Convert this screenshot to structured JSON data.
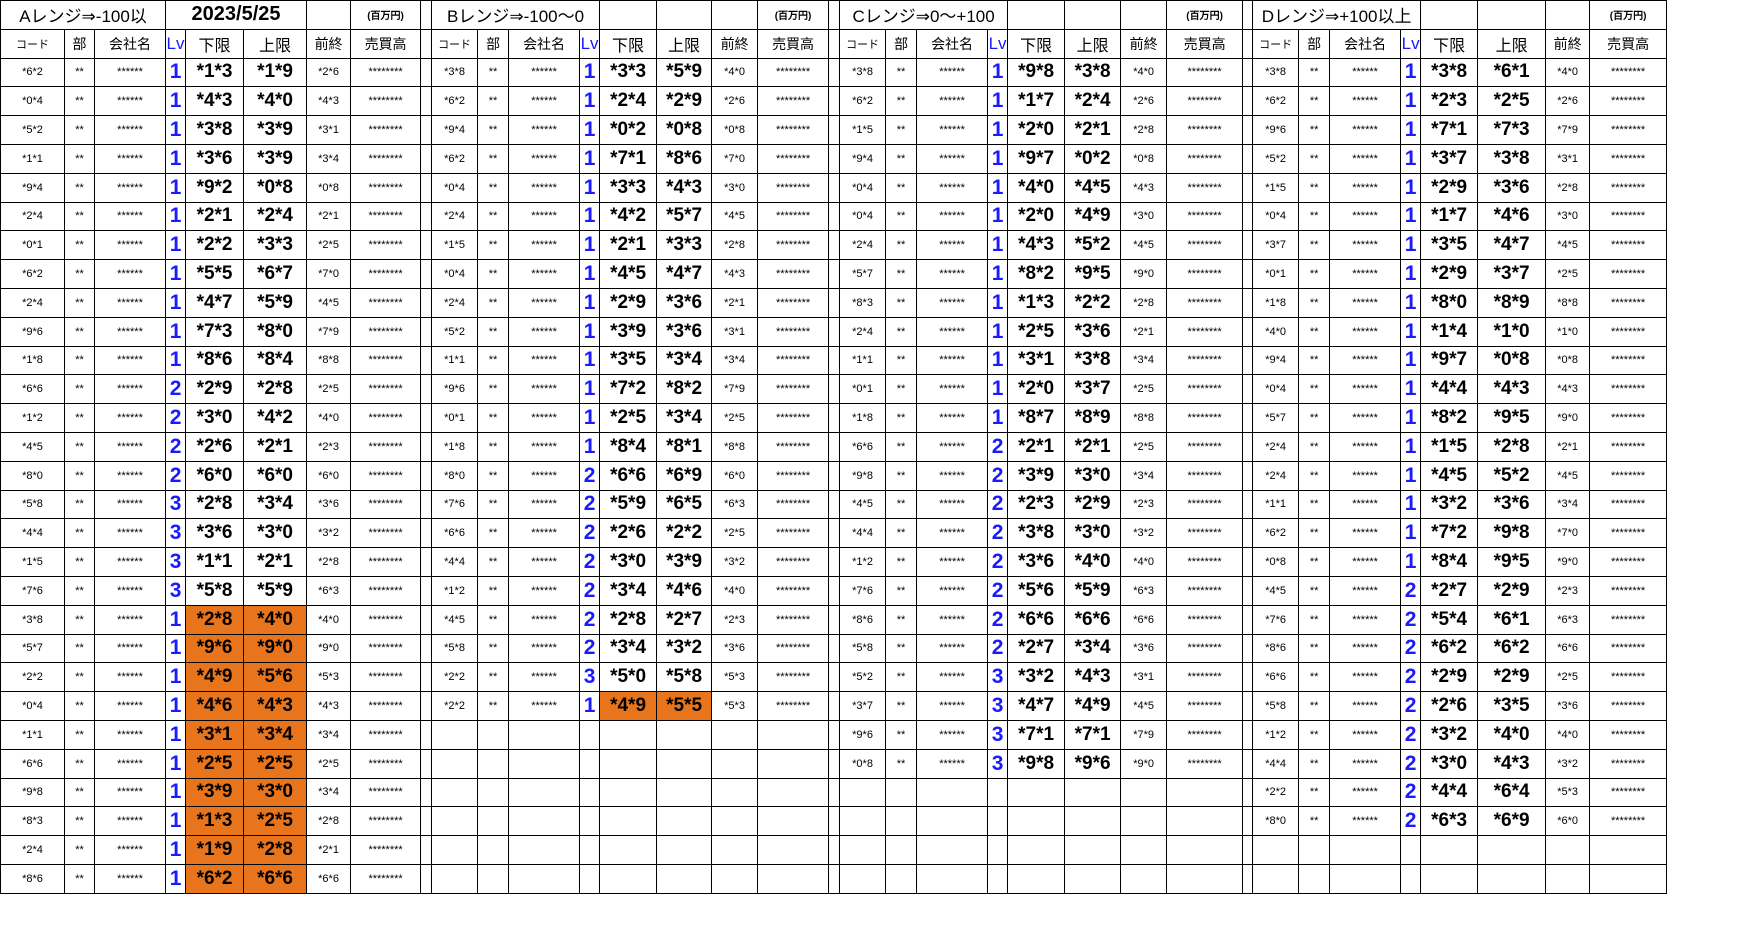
{
  "date": "2023/5/25",
  "unit": "(百万円)",
  "headers": [
    "コード",
    "部",
    "会社名",
    "Lv",
    "下限",
    "上限",
    "前終",
    "売買高"
  ],
  "panels": [
    {
      "title": "Aレンジ⇒-100以",
      "rows": [
        [
          "*6*2",
          "**",
          "******",
          "1",
          "*1*3",
          "*1*9",
          "*2*6",
          "********",
          false
        ],
        [
          "*0*4",
          "**",
          "******",
          "1",
          "*4*3",
          "*4*0",
          "*4*3",
          "********",
          false
        ],
        [
          "*5*2",
          "**",
          "******",
          "1",
          "*3*8",
          "*3*9",
          "*3*1",
          "********",
          false
        ],
        [
          "*1*1",
          "**",
          "******",
          "1",
          "*3*6",
          "*3*9",
          "*3*4",
          "********",
          false
        ],
        [
          "*9*4",
          "**",
          "******",
          "1",
          "*9*2",
          "*0*8",
          "*0*8",
          "********",
          false
        ],
        [
          "*2*4",
          "**",
          "******",
          "1",
          "*2*1",
          "*2*4",
          "*2*1",
          "********",
          false
        ],
        [
          "*0*1",
          "**",
          "******",
          "1",
          "*2*2",
          "*3*3",
          "*2*5",
          "********",
          false
        ],
        [
          "*6*2",
          "**",
          "******",
          "1",
          "*5*5",
          "*6*7",
          "*7*0",
          "********",
          false
        ],
        [
          "*2*4",
          "**",
          "******",
          "1",
          "*4*7",
          "*5*9",
          "*4*5",
          "********",
          false
        ],
        [
          "*9*6",
          "**",
          "******",
          "1",
          "*7*3",
          "*8*0",
          "*7*9",
          "********",
          false
        ],
        [
          "*1*8",
          "**",
          "******",
          "1",
          "*8*6",
          "*8*4",
          "*8*8",
          "********",
          false
        ],
        [
          "*6*6",
          "**",
          "******",
          "2",
          "*2*9",
          "*2*8",
          "*2*5",
          "********",
          false
        ],
        [
          "*1*2",
          "**",
          "******",
          "2",
          "*3*0",
          "*4*2",
          "*4*0",
          "********",
          false
        ],
        [
          "*4*5",
          "**",
          "******",
          "2",
          "*2*6",
          "*2*1",
          "*2*3",
          "********",
          false
        ],
        [
          "*8*0",
          "**",
          "******",
          "2",
          "*6*0",
          "*6*0",
          "*6*0",
          "********",
          false
        ],
        [
          "*5*8",
          "**",
          "******",
          "3",
          "*2*8",
          "*3*4",
          "*3*6",
          "********",
          false
        ],
        [
          "*4*4",
          "**",
          "******",
          "3",
          "*3*6",
          "*3*0",
          "*3*2",
          "********",
          false
        ],
        [
          "*1*5",
          "**",
          "******",
          "3",
          "*1*1",
          "*2*1",
          "*2*8",
          "********",
          false
        ],
        [
          "*7*6",
          "**",
          "******",
          "3",
          "*5*8",
          "*5*9",
          "*6*3",
          "********",
          false
        ],
        [
          "*3*8",
          "**",
          "******",
          "1",
          "*2*8",
          "*4*0",
          "*4*0",
          "********",
          true
        ],
        [
          "*5*7",
          "**",
          "******",
          "1",
          "*9*6",
          "*9*0",
          "*9*0",
          "********",
          true
        ],
        [
          "*2*2",
          "**",
          "******",
          "1",
          "*4*9",
          "*5*6",
          "*5*3",
          "********",
          true
        ],
        [
          "*0*4",
          "**",
          "******",
          "1",
          "*4*6",
          "*4*3",
          "*4*3",
          "********",
          true
        ],
        [
          "*1*1",
          "**",
          "******",
          "1",
          "*3*1",
          "*3*4",
          "*3*4",
          "********",
          true
        ],
        [
          "*6*6",
          "**",
          "******",
          "1",
          "*2*5",
          "*2*5",
          "*2*5",
          "********",
          true
        ],
        [
          "*9*8",
          "**",
          "******",
          "1",
          "*3*9",
          "*3*0",
          "*3*4",
          "********",
          true
        ],
        [
          "*8*3",
          "**",
          "******",
          "1",
          "*1*3",
          "*2*5",
          "*2*8",
          "********",
          true
        ],
        [
          "*2*4",
          "**",
          "******",
          "1",
          "*1*9",
          "*2*8",
          "*2*1",
          "********",
          true
        ],
        [
          "*8*6",
          "**",
          "******",
          "1",
          "*6*2",
          "*6*6",
          "*6*6",
          "********",
          true
        ]
      ]
    },
    {
      "title": "Bレンジ⇒-100～0",
      "rows": [
        [
          "*3*8",
          "**",
          "******",
          "1",
          "*3*3",
          "*5*9",
          "*4*0",
          "********",
          false
        ],
        [
          "*6*2",
          "**",
          "******",
          "1",
          "*2*4",
          "*2*9",
          "*2*6",
          "********",
          false
        ],
        [
          "*9*4",
          "**",
          "******",
          "1",
          "*0*2",
          "*0*8",
          "*0*8",
          "********",
          false
        ],
        [
          "*6*2",
          "**",
          "******",
          "1",
          "*7*1",
          "*8*6",
          "*7*0",
          "********",
          false
        ],
        [
          "*0*4",
          "**",
          "******",
          "1",
          "*3*3",
          "*4*3",
          "*3*0",
          "********",
          false
        ],
        [
          "*2*4",
          "**",
          "******",
          "1",
          "*4*2",
          "*5*7",
          "*4*5",
          "********",
          false
        ],
        [
          "*1*5",
          "**",
          "******",
          "1",
          "*2*1",
          "*3*3",
          "*2*8",
          "********",
          false
        ],
        [
          "*0*4",
          "**",
          "******",
          "1",
          "*4*5",
          "*4*7",
          "*4*3",
          "********",
          false
        ],
        [
          "*2*4",
          "**",
          "******",
          "1",
          "*2*9",
          "*3*6",
          "*2*1",
          "********",
          false
        ],
        [
          "*5*2",
          "**",
          "******",
          "1",
          "*3*9",
          "*3*6",
          "*3*1",
          "********",
          false
        ],
        [
          "*1*1",
          "**",
          "******",
          "1",
          "*3*5",
          "*3*4",
          "*3*4",
          "********",
          false
        ],
        [
          "*9*6",
          "**",
          "******",
          "1",
          "*7*2",
          "*8*2",
          "*7*9",
          "********",
          false
        ],
        [
          "*0*1",
          "**",
          "******",
          "1",
          "*2*5",
          "*3*4",
          "*2*5",
          "********",
          false
        ],
        [
          "*1*8",
          "**",
          "******",
          "1",
          "*8*4",
          "*8*1",
          "*8*8",
          "********",
          false
        ],
        [
          "*8*0",
          "**",
          "******",
          "2",
          "*6*6",
          "*6*9",
          "*6*0",
          "********",
          false
        ],
        [
          "*7*6",
          "**",
          "******",
          "2",
          "*5*9",
          "*6*5",
          "*6*3",
          "********",
          false
        ],
        [
          "*6*6",
          "**",
          "******",
          "2",
          "*2*6",
          "*2*2",
          "*2*5",
          "********",
          false
        ],
        [
          "*4*4",
          "**",
          "******",
          "2",
          "*3*0",
          "*3*9",
          "*3*2",
          "********",
          false
        ],
        [
          "*1*2",
          "**",
          "******",
          "2",
          "*3*4",
          "*4*6",
          "*4*0",
          "********",
          false
        ],
        [
          "*4*5",
          "**",
          "******",
          "2",
          "*2*8",
          "*2*7",
          "*2*3",
          "********",
          false
        ],
        [
          "*5*8",
          "**",
          "******",
          "2",
          "*3*4",
          "*3*2",
          "*3*6",
          "********",
          false
        ],
        [
          "*2*2",
          "**",
          "******",
          "3",
          "*5*0",
          "*5*8",
          "*5*3",
          "********",
          false
        ],
        [
          "*2*2",
          "**",
          "******",
          "1",
          "*4*9",
          "*5*5",
          "*5*3",
          "********",
          true
        ]
      ]
    },
    {
      "title": "Cレンジ⇒0～+100",
      "rows": [
        [
          "*3*8",
          "**",
          "******",
          "1",
          "*9*8",
          "*3*8",
          "*4*0",
          "********",
          false
        ],
        [
          "*6*2",
          "**",
          "******",
          "1",
          "*1*7",
          "*2*4",
          "*2*6",
          "********",
          false
        ],
        [
          "*1*5",
          "**",
          "******",
          "1",
          "*2*0",
          "*2*1",
          "*2*8",
          "********",
          false
        ],
        [
          "*9*4",
          "**",
          "******",
          "1",
          "*9*7",
          "*0*2",
          "*0*8",
          "********",
          false
        ],
        [
          "*0*4",
          "**",
          "******",
          "1",
          "*4*0",
          "*4*5",
          "*4*3",
          "********",
          false
        ],
        [
          "*0*4",
          "**",
          "******",
          "1",
          "*2*0",
          "*4*9",
          "*3*0",
          "********",
          false
        ],
        [
          "*2*4",
          "**",
          "******",
          "1",
          "*4*3",
          "*5*2",
          "*4*5",
          "********",
          false
        ],
        [
          "*5*7",
          "**",
          "******",
          "1",
          "*8*2",
          "*9*5",
          "*9*0",
          "********",
          false
        ],
        [
          "*8*3",
          "**",
          "******",
          "1",
          "*1*3",
          "*2*2",
          "*2*8",
          "********",
          false
        ],
        [
          "*2*4",
          "**",
          "******",
          "1",
          "*2*5",
          "*3*6",
          "*2*1",
          "********",
          false
        ],
        [
          "*1*1",
          "**",
          "******",
          "1",
          "*3*1",
          "*3*8",
          "*3*4",
          "********",
          false
        ],
        [
          "*0*1",
          "**",
          "******",
          "1",
          "*2*0",
          "*3*7",
          "*2*5",
          "********",
          false
        ],
        [
          "*1*8",
          "**",
          "******",
          "1",
          "*8*7",
          "*8*9",
          "*8*8",
          "********",
          false
        ],
        [
          "*6*6",
          "**",
          "******",
          "2",
          "*2*1",
          "*2*1",
          "*2*5",
          "********",
          false
        ],
        [
          "*9*8",
          "**",
          "******",
          "2",
          "*3*9",
          "*3*0",
          "*3*4",
          "********",
          false
        ],
        [
          "*4*5",
          "**",
          "******",
          "2",
          "*2*3",
          "*2*9",
          "*2*3",
          "********",
          false
        ],
        [
          "*4*4",
          "**",
          "******",
          "2",
          "*3*8",
          "*3*0",
          "*3*2",
          "********",
          false
        ],
        [
          "*1*2",
          "**",
          "******",
          "2",
          "*3*6",
          "*4*0",
          "*4*0",
          "********",
          false
        ],
        [
          "*7*6",
          "**",
          "******",
          "2",
          "*5*6",
          "*5*9",
          "*6*3",
          "********",
          false
        ],
        [
          "*8*6",
          "**",
          "******",
          "2",
          "*6*6",
          "*6*6",
          "*6*6",
          "********",
          false
        ],
        [
          "*5*8",
          "**",
          "******",
          "2",
          "*2*7",
          "*3*4",
          "*3*6",
          "********",
          false
        ],
        [
          "*5*2",
          "**",
          "******",
          "3",
          "*3*2",
          "*4*3",
          "*3*1",
          "********",
          false
        ],
        [
          "*3*7",
          "**",
          "******",
          "3",
          "*4*7",
          "*4*9",
          "*4*5",
          "********",
          false
        ],
        [
          "*9*6",
          "**",
          "******",
          "3",
          "*7*1",
          "*7*1",
          "*7*9",
          "********",
          false
        ],
        [
          "*0*8",
          "**",
          "******",
          "3",
          "*9*8",
          "*9*6",
          "*9*0",
          "********",
          false
        ]
      ]
    },
    {
      "title": "Dレンジ⇒+100以上",
      "rows": [
        [
          "*3*8",
          "**",
          "******",
          "1",
          "*3*8",
          "*6*1",
          "*4*0",
          "********",
          false
        ],
        [
          "*6*2",
          "**",
          "******",
          "1",
          "*2*3",
          "*2*5",
          "*2*6",
          "********",
          false
        ],
        [
          "*9*6",
          "**",
          "******",
          "1",
          "*7*1",
          "*7*3",
          "*7*9",
          "********",
          false
        ],
        [
          "*5*2",
          "**",
          "******",
          "1",
          "*3*7",
          "*3*8",
          "*3*1",
          "********",
          false
        ],
        [
          "*1*5",
          "**",
          "******",
          "1",
          "*2*9",
          "*3*6",
          "*2*8",
          "********",
          false
        ],
        [
          "*0*4",
          "**",
          "******",
          "1",
          "*1*7",
          "*4*6",
          "*3*0",
          "********",
          false
        ],
        [
          "*3*7",
          "**",
          "******",
          "1",
          "*3*5",
          "*4*7",
          "*4*5",
          "********",
          false
        ],
        [
          "*0*1",
          "**",
          "******",
          "1",
          "*2*9",
          "*3*7",
          "*2*5",
          "********",
          false
        ],
        [
          "*1*8",
          "**",
          "******",
          "1",
          "*8*0",
          "*8*9",
          "*8*8",
          "********",
          false
        ],
        [
          "*4*0",
          "**",
          "******",
          "1",
          "*1*4",
          "*1*0",
          "*1*0",
          "********",
          false
        ],
        [
          "*9*4",
          "**",
          "******",
          "1",
          "*9*7",
          "*0*8",
          "*0*8",
          "********",
          false
        ],
        [
          "*0*4",
          "**",
          "******",
          "1",
          "*4*4",
          "*4*3",
          "*4*3",
          "********",
          false
        ],
        [
          "*5*7",
          "**",
          "******",
          "1",
          "*8*2",
          "*9*5",
          "*9*0",
          "********",
          false
        ],
        [
          "*2*4",
          "**",
          "******",
          "1",
          "*1*5",
          "*2*8",
          "*2*1",
          "********",
          false
        ],
        [
          "*2*4",
          "**",
          "******",
          "1",
          "*4*5",
          "*5*2",
          "*4*5",
          "********",
          false
        ],
        [
          "*1*1",
          "**",
          "******",
          "1",
          "*3*2",
          "*3*6",
          "*3*4",
          "********",
          false
        ],
        [
          "*6*2",
          "**",
          "******",
          "1",
          "*7*2",
          "*9*8",
          "*7*0",
          "********",
          false
        ],
        [
          "*0*8",
          "**",
          "******",
          "1",
          "*8*4",
          "*9*5",
          "*9*0",
          "********",
          false
        ],
        [
          "*4*5",
          "**",
          "******",
          "2",
          "*2*7",
          "*2*9",
          "*2*3",
          "********",
          false
        ],
        [
          "*7*6",
          "**",
          "******",
          "2",
          "*5*4",
          "*6*1",
          "*6*3",
          "********",
          false
        ],
        [
          "*8*6",
          "**",
          "******",
          "2",
          "*6*2",
          "*6*2",
          "*6*6",
          "********",
          false
        ],
        [
          "*6*6",
          "**",
          "******",
          "2",
          "*2*9",
          "*2*9",
          "*2*5",
          "********",
          false
        ],
        [
          "*5*8",
          "**",
          "******",
          "2",
          "*2*6",
          "*3*5",
          "*3*6",
          "********",
          false
        ],
        [
          "*1*2",
          "**",
          "******",
          "2",
          "*3*2",
          "*4*0",
          "*4*0",
          "********",
          false
        ],
        [
          "*4*4",
          "**",
          "******",
          "2",
          "*3*0",
          "*4*3",
          "*3*2",
          "********",
          false
        ],
        [
          "*2*2",
          "**",
          "******",
          "2",
          "*4*4",
          "*6*4",
          "*5*3",
          "********",
          false
        ],
        [
          "*8*0",
          "**",
          "******",
          "2",
          "*6*3",
          "*6*9",
          "*6*0",
          "********",
          false
        ]
      ]
    }
  ],
  "colors": {
    "highlight": "#e8741c",
    "lv_text": "#1a1aff",
    "border": "#000000"
  }
}
